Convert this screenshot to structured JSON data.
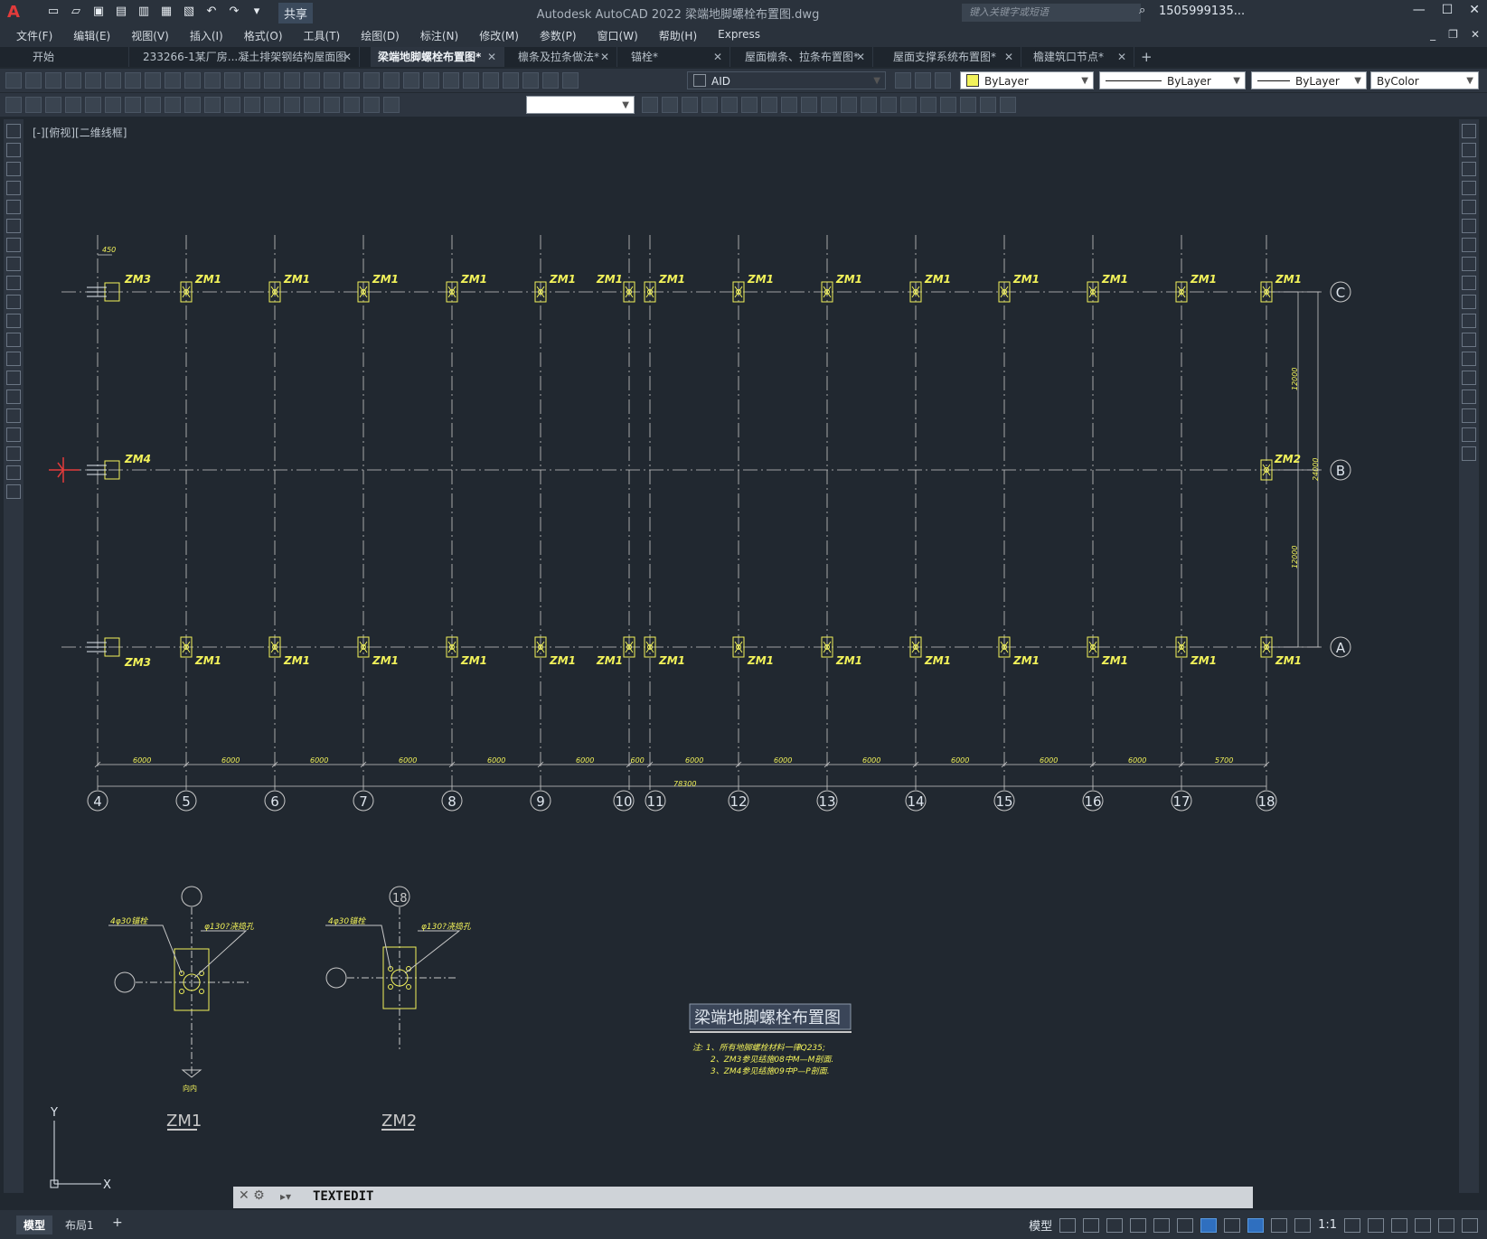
{
  "titlebar": {
    "app_title": "Autodesk AutoCAD 2022    梁端地脚螺栓布置图.dwg",
    "share_label": "共享",
    "search_placeholder": "键入关键字或短语",
    "user": "1505999135...",
    "logo": "A"
  },
  "menu": [
    "文件(F)",
    "编辑(E)",
    "视图(V)",
    "插入(I)",
    "格式(O)",
    "工具(T)",
    "绘图(D)",
    "标注(N)",
    "修改(M)",
    "参数(P)",
    "窗口(W)",
    "帮助(H)",
    "Express"
  ],
  "tabs": [
    {
      "label": "开始",
      "active": false
    },
    {
      "label": "233266-1某厂房...凝土排架钢结构屋面图",
      "active": false
    },
    {
      "label": "梁端地脚螺栓布置图*",
      "active": true
    },
    {
      "label": "檩条及拉条做法*",
      "active": false
    },
    {
      "label": "锚栓*",
      "active": false
    },
    {
      "label": "屋面檩条、拉条布置图*",
      "active": false
    },
    {
      "label": "屋面支撑系统布置图*",
      "active": false
    },
    {
      "label": "檐建筑口节点*",
      "active": false
    }
  ],
  "properties": {
    "layer": "AID",
    "color": "ByLayer",
    "linetype": "ByLayer",
    "lineweight": "ByLayer",
    "plotstyle": "ByColor"
  },
  "viewport": {
    "label": "[-][俯视][二维线框]",
    "grid_columns": [
      "4",
      "5",
      "6",
      "7",
      "8",
      "9",
      "10",
      "11",
      "12",
      "13",
      "14",
      "15",
      "16",
      "17",
      "18"
    ],
    "grid_rows": [
      "C",
      "B",
      "A"
    ],
    "dims_bottom": [
      "6000",
      "6000",
      "6000",
      "6000",
      "6000",
      "6000",
      "600",
      "6000",
      "6000",
      "6000",
      "6000",
      "6000",
      "6000",
      "5700"
    ],
    "dim_total": "78300",
    "dims_right": [
      "12000",
      "12000"
    ],
    "dim_right_total": "24000",
    "dim_top": "450",
    "label_zm1": "ZM1",
    "label_zm2": "ZM2",
    "label_zm3": "ZM3",
    "label_zm4": "ZM4",
    "detail1_title": "ZM1",
    "detail2_title": "ZM2",
    "detail2_axis": "18",
    "detail_bolt_note": "4φ30锚栓",
    "detail_hole_note": "φ130?浇捣孔",
    "detail_dir": "向内",
    "drawing_title": "梁端地脚螺栓布置图",
    "notes": [
      "注:   1、所有地脚螺栓材料一律Q235;",
      "2、ZM3参见结施08中M—M剖面.",
      "3、ZM4参见结施09中P—P剖面."
    ],
    "ucs_x": "X",
    "ucs_y": "Y"
  },
  "command": "TEXTEDIT",
  "status": {
    "tabs": [
      "模型",
      "布局1"
    ],
    "model_label": "模型",
    "scale": "1:1"
  },
  "colors": {
    "background": "#212830",
    "grid_line": "#c8c8c8",
    "yellow": "#f2f25a",
    "accent_red": "#e23b3b"
  }
}
